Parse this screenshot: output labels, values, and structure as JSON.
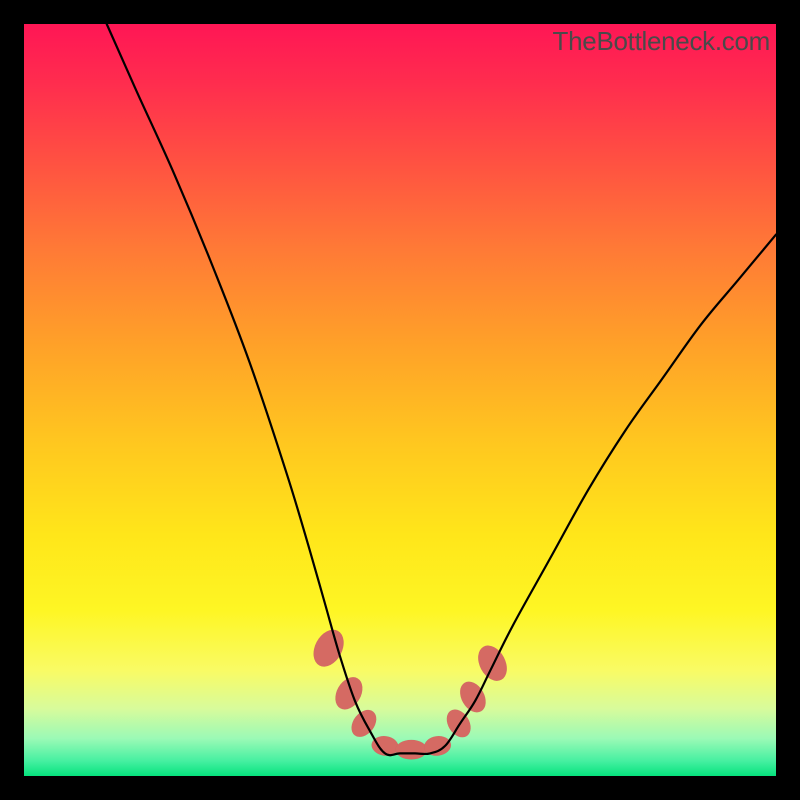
{
  "watermark": "TheBottleneck.com",
  "colors": {
    "page_bg": "#000000",
    "gradient_top": "#ff1655",
    "gradient_mid": "#ffe61a",
    "gradient_bottom": "#06e27d",
    "curve_stroke": "#000000",
    "blob_fill": "#d56a63",
    "watermark_text": "#4a4a4a"
  },
  "chart_data": {
    "type": "line",
    "title": "",
    "xlabel": "",
    "ylabel": "",
    "xlim": [
      0,
      100
    ],
    "ylim": [
      0,
      100
    ],
    "grid": false,
    "note": "V-shaped curve with flat bottom; y encodes relative bottleneck / mismatch (100 = top of frame, 0 = bottom). x and y are in percent of the plotting frame. Values read off the figure geometry.",
    "series": [
      {
        "name": "bottleneck-curve",
        "x": [
          11,
          15,
          20,
          25,
          30,
          35,
          38,
          40,
          42,
          44,
          46,
          48,
          50,
          52,
          54,
          56,
          58,
          60,
          62,
          65,
          70,
          75,
          80,
          85,
          90,
          95,
          100
        ],
        "y": [
          100,
          91,
          80,
          68,
          55,
          40,
          30,
          23,
          16,
          10,
          6,
          3,
          3,
          3,
          3,
          4,
          7,
          10,
          14,
          20,
          29,
          38,
          46,
          53,
          60,
          66,
          72
        ]
      }
    ],
    "markers": [
      {
        "name": "left-blob-1",
        "cx": 40.5,
        "cy": 17,
        "rx": 1.8,
        "ry": 2.6,
        "rot": 28
      },
      {
        "name": "left-blob-2",
        "cx": 43.2,
        "cy": 11,
        "rx": 1.6,
        "ry": 2.3,
        "rot": 30
      },
      {
        "name": "left-blob-3",
        "cx": 45.2,
        "cy": 7,
        "rx": 1.4,
        "ry": 2.0,
        "rot": 38
      },
      {
        "name": "floor-blob-1",
        "cx": 48.0,
        "cy": 4,
        "rx": 1.8,
        "ry": 1.3,
        "rot": 8
      },
      {
        "name": "floor-blob-2",
        "cx": 51.5,
        "cy": 3.5,
        "rx": 2.1,
        "ry": 1.3,
        "rot": 0
      },
      {
        "name": "floor-blob-3",
        "cx": 55.0,
        "cy": 4,
        "rx": 1.8,
        "ry": 1.3,
        "rot": -8
      },
      {
        "name": "right-blob-1",
        "cx": 57.8,
        "cy": 7,
        "rx": 1.4,
        "ry": 2.0,
        "rot": -32
      },
      {
        "name": "right-blob-2",
        "cx": 59.7,
        "cy": 10.5,
        "rx": 1.5,
        "ry": 2.2,
        "rot": -30
      },
      {
        "name": "right-blob-3",
        "cx": 62.3,
        "cy": 15,
        "rx": 1.7,
        "ry": 2.5,
        "rot": -28
      }
    ]
  }
}
